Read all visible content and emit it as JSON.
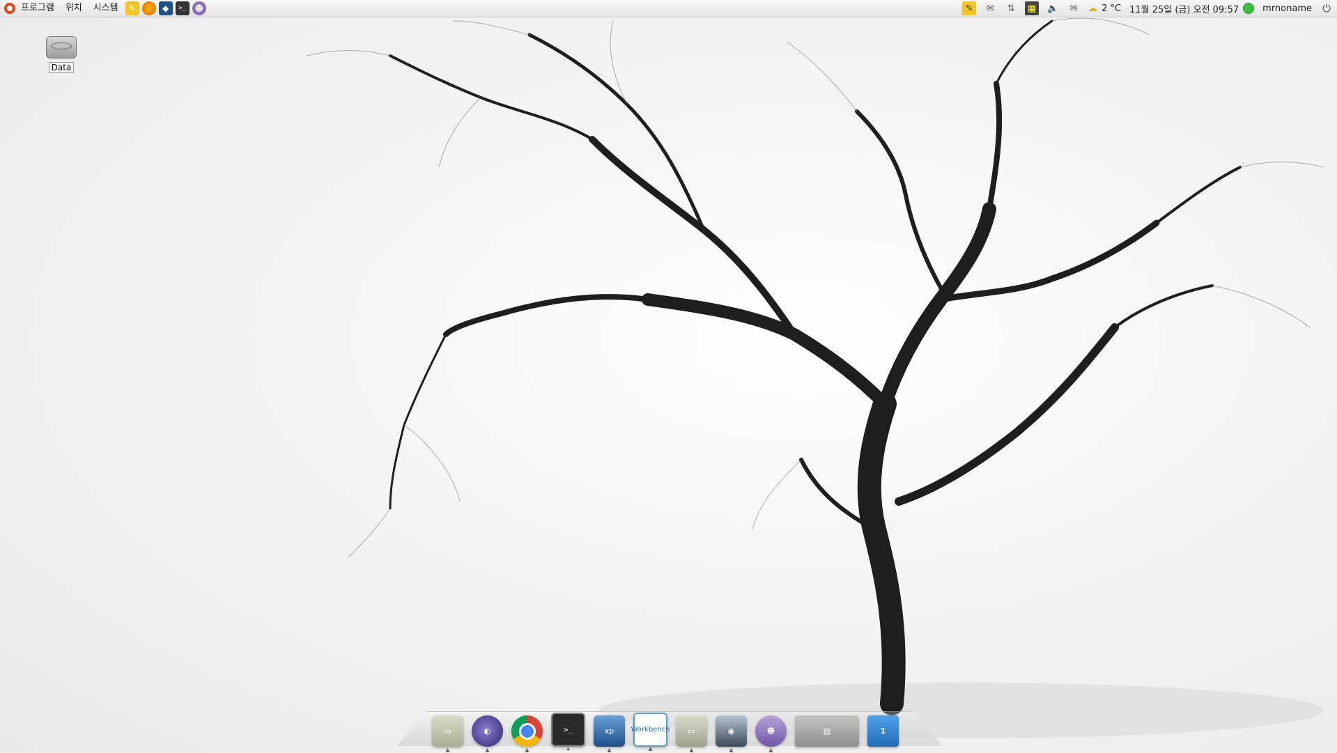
{
  "top_panel": {
    "menus": [
      "프로그램",
      "위치",
      "시스템"
    ],
    "launchers": [
      {
        "icon": "notes-icon",
        "color": "#f3c623"
      },
      {
        "icon": "firefox-icon",
        "color": "#e66000"
      },
      {
        "icon": "virtualbox-icon",
        "color": "#1d4f8a"
      },
      {
        "icon": "terminal-icon",
        "color": "#333333"
      },
      {
        "icon": "pidgin-icon",
        "color": "#8a6fc0"
      }
    ],
    "weather": "2 °C",
    "datetime": "11월 25일 (금) 오전 09:57",
    "username": "mrnoname"
  },
  "desktop": {
    "icons": [
      {
        "label": "Data",
        "icon": "hard-drive-icon"
      }
    ]
  },
  "dock": {
    "items": [
      {
        "name": "files",
        "icon": "folder-icon"
      },
      {
        "name": "eclipse",
        "icon": "eclipse-icon"
      },
      {
        "name": "chrome",
        "icon": "chrome-icon"
      },
      {
        "name": "terminal",
        "icon": "terminal-icon",
        "text": ">_"
      },
      {
        "name": "virtualbox",
        "icon": "virtualbox-icon",
        "text": "xp"
      },
      {
        "name": "mysql-workbench",
        "icon": "workbench-icon",
        "text": "Workbench"
      },
      {
        "name": "home-folder",
        "icon": "folder-icon"
      },
      {
        "name": "speakers",
        "icon": "speaker-icon"
      },
      {
        "name": "pidgin",
        "icon": "pidgin-icon"
      },
      {
        "name": "window-thumbnail",
        "icon": "window-icon"
      },
      {
        "name": "trash",
        "icon": "trash-icon",
        "text": "1"
      }
    ]
  }
}
